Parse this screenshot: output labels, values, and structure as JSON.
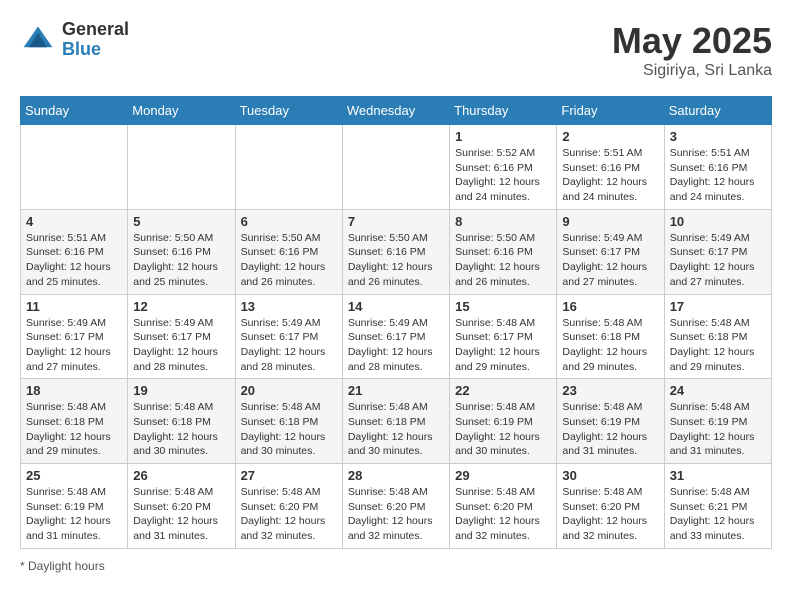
{
  "header": {
    "logo_general": "General",
    "logo_blue": "Blue",
    "month": "May 2025",
    "location": "Sigiriya, Sri Lanka"
  },
  "days_of_week": [
    "Sunday",
    "Monday",
    "Tuesday",
    "Wednesday",
    "Thursday",
    "Friday",
    "Saturday"
  ],
  "footer": {
    "note": "Daylight hours"
  },
  "weeks": [
    {
      "days": [
        {
          "number": "",
          "info": ""
        },
        {
          "number": "",
          "info": ""
        },
        {
          "number": "",
          "info": ""
        },
        {
          "number": "",
          "info": ""
        },
        {
          "number": "1",
          "info": "Sunrise: 5:52 AM\nSunset: 6:16 PM\nDaylight: 12 hours\nand 24 minutes."
        },
        {
          "number": "2",
          "info": "Sunrise: 5:51 AM\nSunset: 6:16 PM\nDaylight: 12 hours\nand 24 minutes."
        },
        {
          "number": "3",
          "info": "Sunrise: 5:51 AM\nSunset: 6:16 PM\nDaylight: 12 hours\nand 24 minutes."
        }
      ]
    },
    {
      "days": [
        {
          "number": "4",
          "info": "Sunrise: 5:51 AM\nSunset: 6:16 PM\nDaylight: 12 hours\nand 25 minutes."
        },
        {
          "number": "5",
          "info": "Sunrise: 5:50 AM\nSunset: 6:16 PM\nDaylight: 12 hours\nand 25 minutes."
        },
        {
          "number": "6",
          "info": "Sunrise: 5:50 AM\nSunset: 6:16 PM\nDaylight: 12 hours\nand 26 minutes."
        },
        {
          "number": "7",
          "info": "Sunrise: 5:50 AM\nSunset: 6:16 PM\nDaylight: 12 hours\nand 26 minutes."
        },
        {
          "number": "8",
          "info": "Sunrise: 5:50 AM\nSunset: 6:16 PM\nDaylight: 12 hours\nand 26 minutes."
        },
        {
          "number": "9",
          "info": "Sunrise: 5:49 AM\nSunset: 6:17 PM\nDaylight: 12 hours\nand 27 minutes."
        },
        {
          "number": "10",
          "info": "Sunrise: 5:49 AM\nSunset: 6:17 PM\nDaylight: 12 hours\nand 27 minutes."
        }
      ]
    },
    {
      "days": [
        {
          "number": "11",
          "info": "Sunrise: 5:49 AM\nSunset: 6:17 PM\nDaylight: 12 hours\nand 27 minutes."
        },
        {
          "number": "12",
          "info": "Sunrise: 5:49 AM\nSunset: 6:17 PM\nDaylight: 12 hours\nand 28 minutes."
        },
        {
          "number": "13",
          "info": "Sunrise: 5:49 AM\nSunset: 6:17 PM\nDaylight: 12 hours\nand 28 minutes."
        },
        {
          "number": "14",
          "info": "Sunrise: 5:49 AM\nSunset: 6:17 PM\nDaylight: 12 hours\nand 28 minutes."
        },
        {
          "number": "15",
          "info": "Sunrise: 5:48 AM\nSunset: 6:17 PM\nDaylight: 12 hours\nand 29 minutes."
        },
        {
          "number": "16",
          "info": "Sunrise: 5:48 AM\nSunset: 6:18 PM\nDaylight: 12 hours\nand 29 minutes."
        },
        {
          "number": "17",
          "info": "Sunrise: 5:48 AM\nSunset: 6:18 PM\nDaylight: 12 hours\nand 29 minutes."
        }
      ]
    },
    {
      "days": [
        {
          "number": "18",
          "info": "Sunrise: 5:48 AM\nSunset: 6:18 PM\nDaylight: 12 hours\nand 29 minutes."
        },
        {
          "number": "19",
          "info": "Sunrise: 5:48 AM\nSunset: 6:18 PM\nDaylight: 12 hours\nand 30 minutes."
        },
        {
          "number": "20",
          "info": "Sunrise: 5:48 AM\nSunset: 6:18 PM\nDaylight: 12 hours\nand 30 minutes."
        },
        {
          "number": "21",
          "info": "Sunrise: 5:48 AM\nSunset: 6:18 PM\nDaylight: 12 hours\nand 30 minutes."
        },
        {
          "number": "22",
          "info": "Sunrise: 5:48 AM\nSunset: 6:19 PM\nDaylight: 12 hours\nand 30 minutes."
        },
        {
          "number": "23",
          "info": "Sunrise: 5:48 AM\nSunset: 6:19 PM\nDaylight: 12 hours\nand 31 minutes."
        },
        {
          "number": "24",
          "info": "Sunrise: 5:48 AM\nSunset: 6:19 PM\nDaylight: 12 hours\nand 31 minutes."
        }
      ]
    },
    {
      "days": [
        {
          "number": "25",
          "info": "Sunrise: 5:48 AM\nSunset: 6:19 PM\nDaylight: 12 hours\nand 31 minutes."
        },
        {
          "number": "26",
          "info": "Sunrise: 5:48 AM\nSunset: 6:20 PM\nDaylight: 12 hours\nand 31 minutes."
        },
        {
          "number": "27",
          "info": "Sunrise: 5:48 AM\nSunset: 6:20 PM\nDaylight: 12 hours\nand 32 minutes."
        },
        {
          "number": "28",
          "info": "Sunrise: 5:48 AM\nSunset: 6:20 PM\nDaylight: 12 hours\nand 32 minutes."
        },
        {
          "number": "29",
          "info": "Sunrise: 5:48 AM\nSunset: 6:20 PM\nDaylight: 12 hours\nand 32 minutes."
        },
        {
          "number": "30",
          "info": "Sunrise: 5:48 AM\nSunset: 6:20 PM\nDaylight: 12 hours\nand 32 minutes."
        },
        {
          "number": "31",
          "info": "Sunrise: 5:48 AM\nSunset: 6:21 PM\nDaylight: 12 hours\nand 33 minutes."
        }
      ]
    }
  ]
}
